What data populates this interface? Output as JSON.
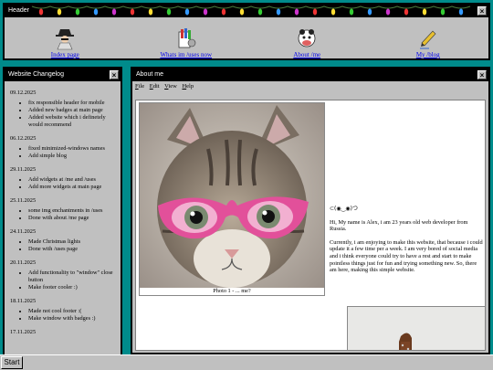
{
  "header": {
    "title": "Header",
    "close": "×",
    "nav": [
      {
        "label": "Index page",
        "icon": "spy-icon"
      },
      {
        "label": "Whats im /uses now",
        "icon": "paint-tools-icon"
      },
      {
        "label": "About /me",
        "icon": "cow-icon"
      },
      {
        "label": "My /blog",
        "icon": "pen-icon"
      }
    ]
  },
  "changelog": {
    "title": "Website Changelog",
    "close": "×",
    "entries": [
      {
        "date": "09.12.2025",
        "items": [
          "fix responsible header for mobile",
          "Added new badges at main page",
          "Added website which i definetely would recommend"
        ]
      },
      {
        "date": "06.12.2025",
        "items": [
          "fixed minimized-windows names",
          "Add simple blog"
        ]
      },
      {
        "date": "29.11.2025",
        "items": [
          "Add widgets at /me and /uses",
          "Add more widgets at main page"
        ]
      },
      {
        "date": "25.11.2025",
        "items": [
          "some img enchantments in /uses",
          "Done with about /me page"
        ]
      },
      {
        "date": "24.11.2025",
        "items": [
          "Made Christmas lights",
          "Done with /uses page"
        ]
      },
      {
        "date": "20.11.2025",
        "items": [
          "Add functionality to \"window\" close button",
          "Make footer cooler :)"
        ]
      },
      {
        "date": "18.11.2025",
        "items": [
          "Made not cool footer :(",
          "Make window with badges :)"
        ]
      },
      {
        "date": "17.11.2025",
        "items": []
      }
    ]
  },
  "about": {
    "title": "About me",
    "close": "×",
    "menu": [
      {
        "key": "F",
        "rest": "ile"
      },
      {
        "key": "E",
        "rest": "dit"
      },
      {
        "key": "V",
        "rest": "iew"
      },
      {
        "key": "H",
        "rest": "elp"
      }
    ],
    "photo_caption": "Photo 1 - ... me?",
    "kaomoji": "⊂(◉‿◉)つ",
    "paragraphs": [
      "Hi, My name is Alex, i am 23 years old web developer from Russia.",
      "Currently, i am enjoying to make this website, that because i could update it a few time per a week. I am very bored of social media and i think everyone could try to have a rest and start to make pointless things just for fun and trying something new. So, there am here, making this simple website."
    ]
  },
  "taskbar": {
    "start_label": "Start"
  },
  "colors": {
    "desktop": "#008b8b",
    "window": "#c0c0c0",
    "titlebar": "#000000",
    "link": "#0000ee"
  }
}
